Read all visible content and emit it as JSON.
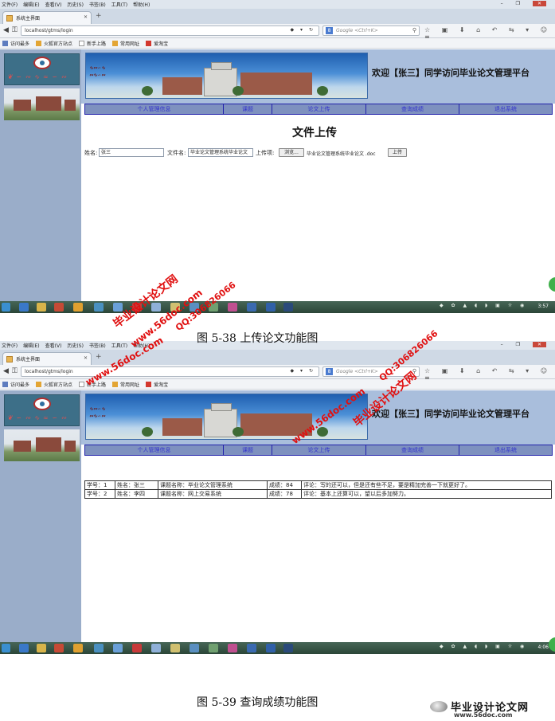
{
  "browser": {
    "menu": [
      "文件(F)",
      "编辑(E)",
      "查看(V)",
      "历史(S)",
      "书签(B)",
      "工具(T)",
      "帮助(H)"
    ],
    "tab_title": "系统主界面",
    "url": "localhost/gtms/login",
    "search_placeholder": "Google <Ctrl+K>",
    "bookmarks": [
      "访问最多",
      "火狐官方站点",
      "新手上路",
      "常用网址",
      "爱淘宝"
    ]
  },
  "site": {
    "welcome": "欢迎【张三】同学访问毕业论文管理平台",
    "nav": [
      "个人管理信息",
      "课题",
      "论文上传",
      "查询成绩",
      "退出系统"
    ]
  },
  "upload": {
    "title": "文件上传",
    "name_label": "姓名:",
    "name_value": "张三",
    "file_label": "文件名:",
    "file_value": "毕业论文管理系统毕业论文",
    "item_label": "上传项:",
    "browse_label": "浏览...",
    "chosen_file": "毕业论文管理系统毕业论文 .doc",
    "submit_label": "上传"
  },
  "grades": {
    "rows": [
      [
        "学号：1",
        "姓名：张三",
        "课题名称：毕业论文管理系统",
        "成绩：84",
        "评论：写的还可以，但是还有些不足，要是精加完善一下就更好了。"
      ],
      [
        "学号：2",
        "姓名：李四",
        "课题名称：网上交易系统",
        "成绩：78",
        "评论：基本上还算可以，望以后多加努力。"
      ]
    ]
  },
  "taskbar": {
    "clock1": "3:57",
    "clock2": "4:06"
  },
  "captions": {
    "fig1": "图 5-38 上传论文功能图",
    "fig2": "图 5-39 查询成绩功能图"
  },
  "watermarks": {
    "site_cn": "毕业设计论文网",
    "url": "www.56doc.com",
    "qq": "QQ:306826066"
  },
  "footer_logo": {
    "name": "毕业设计论文网",
    "url": "www.56doc.com"
  }
}
